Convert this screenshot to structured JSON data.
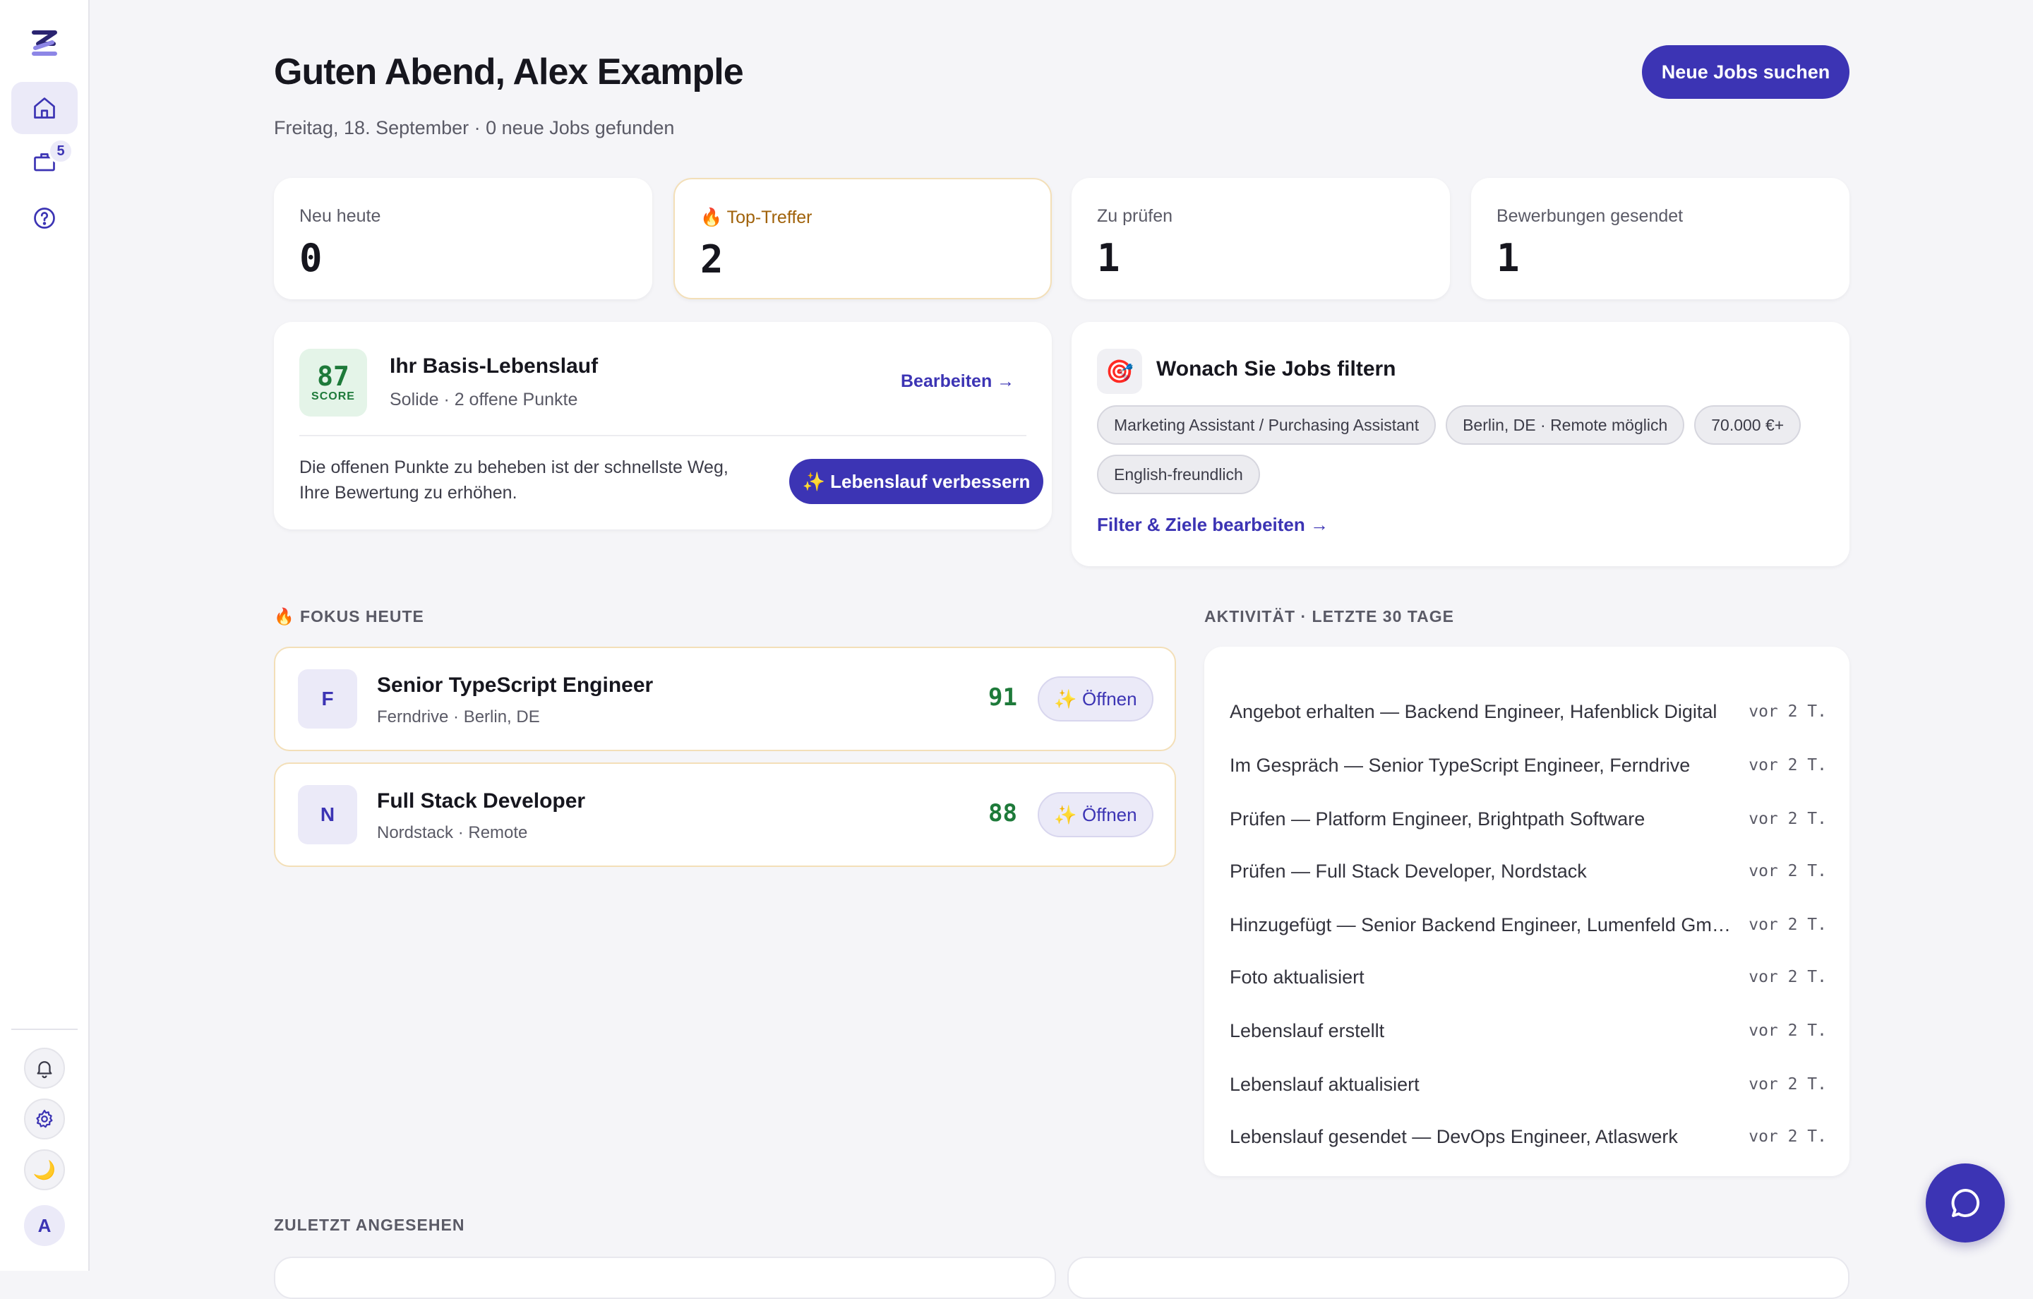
{
  "sidebar": {
    "logo": "Z",
    "nav": [
      {
        "icon": "home-icon"
      },
      {
        "icon": "briefcase-icon",
        "badge": "5"
      },
      {
        "icon": "help-icon"
      }
    ],
    "bottom": [
      {
        "icon": "bell-icon"
      },
      {
        "icon": "gear-icon"
      },
      {
        "icon": "moon-icon",
        "glyph": "🌙"
      }
    ],
    "avatar": "A"
  },
  "header": {
    "title": "Guten Abend, Alex Example",
    "subtitle": "Freitag, 18. September · 0 neue Jobs gefunden",
    "cta": "Neue Jobs suchen"
  },
  "stats": [
    {
      "label": "Neu heute",
      "value": "0"
    },
    {
      "label": "🔥 Top-Treffer",
      "value": "2"
    },
    {
      "label": "Zu prüfen",
      "value": "1"
    },
    {
      "label": "Bewerbungen gesendet",
      "value": "1"
    }
  ],
  "cv": {
    "score": "87",
    "score_label": "SCORE",
    "title": "Ihr Basis-Lebenslauf",
    "subtitle": "Solide · 2 offene Punkte",
    "edit": "Bearbeiten →",
    "text": "Die offenen Punkte zu beheben ist der schnellste Weg, Ihre Bewertung zu erhöhen.",
    "improve": "✨ Lebenslauf verbessern"
  },
  "filters": {
    "icon": "🎯",
    "title": "Wonach Sie Jobs filtern",
    "chips": [
      "Marketing Assistant / Purchasing Assistant",
      "Berlin, DE · Remote möglich",
      "70.000 €+",
      "English-freundlich"
    ],
    "link": "Filter & Ziele bearbeiten →"
  },
  "focus": {
    "heading": "🔥 FOKUS HEUTE",
    "jobs": [
      {
        "logo": "F",
        "title": "Senior TypeScript Engineer",
        "sub": "Ferndrive · Berlin, DE",
        "score": "91",
        "action": "✨ Öffnen"
      },
      {
        "logo": "N",
        "title": "Full Stack Developer",
        "sub": "Nordstack · Remote",
        "score": "88",
        "action": "✨ Öffnen"
      }
    ]
  },
  "activity": {
    "heading": "AKTIVITÄT · LETZTE 30 TAGE",
    "items": [
      {
        "text": "Angebot erhalten — Backend Engineer, Hafenblick Digital",
        "time": "vor 2 T."
      },
      {
        "text": "Im Gespräch — Senior TypeScript Engineer, Ferndrive",
        "time": "vor 2 T."
      },
      {
        "text": "Prüfen — Platform Engineer, Brightpath Software",
        "time": "vor 2 T."
      },
      {
        "text": "Prüfen — Full Stack Developer, Nordstack",
        "time": "vor 2 T."
      },
      {
        "text": "Hinzugefügt — Senior Backend Engineer, Lumenfeld Gm…",
        "time": "vor 2 T."
      },
      {
        "text": "Foto aktualisiert",
        "time": "vor 2 T."
      },
      {
        "text": "Lebenslauf erstellt",
        "time": "vor 2 T."
      },
      {
        "text": "Lebenslauf aktualisiert",
        "time": "vor 2 T."
      },
      {
        "text": "Lebenslauf gesendet — DevOps Engineer, Atlaswerk",
        "time": "vor 2 T."
      }
    ]
  },
  "recent": {
    "heading": "ZULETZT ANGESEHEN"
  },
  "chat": {
    "icon": "chat-bubble-icon"
  },
  "colors": {
    "accent": "#3c34b4",
    "score_green": "#1e7a3a",
    "hot": "#a0620a",
    "background": "#f5f5f8"
  }
}
